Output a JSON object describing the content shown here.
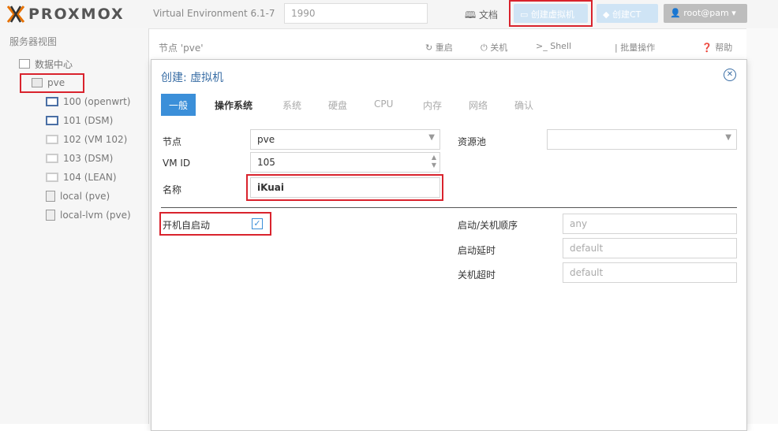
{
  "header": {
    "logo": "PROXMOX",
    "version": "Virtual Environment 6.1-7",
    "search_value": "1990",
    "docs_label": "文档",
    "create_vm_label": "创建虚拟机",
    "create_ct_label": "创建CT",
    "user_label": "root@pam"
  },
  "sidebar": {
    "title": "服务器视图",
    "datacenter": "数据中心",
    "node": "pve",
    "items": [
      {
        "label": "100 (openwrt)"
      },
      {
        "label": "101 (DSM)"
      },
      {
        "label": "102 (VM 102)"
      },
      {
        "label": "103 (DSM)"
      },
      {
        "label": "104 (LEAN)"
      },
      {
        "label": "local (pve)"
      },
      {
        "label": "local-lvm (pve)"
      }
    ]
  },
  "toolbar": {
    "title": "节点 'pve'",
    "restart": "重启",
    "shutdown": "关机",
    "shell": "Shell",
    "bulk": "批量操作",
    "help": "帮助"
  },
  "dialog": {
    "title": "创建: 虚拟机",
    "tabs": [
      "一般",
      "操作系统",
      "系统",
      "硬盘",
      "CPU",
      "内存",
      "网络",
      "确认"
    ],
    "node_label": "节点",
    "node_value": "pve",
    "vmid_label": "VM ID",
    "vmid_value": "105",
    "name_label": "名称",
    "name_value": "iKuai",
    "pool_label": "资源池",
    "autostart_label": "开机自启动",
    "order_label": "启动/关机顺序",
    "order_value": "any",
    "startup_delay_label": "启动延时",
    "startup_delay_value": "default",
    "shutdown_timeout_label": "关机超时",
    "shutdown_timeout_value": "default"
  },
  "colors": {
    "accent": "#3b8fd9",
    "highlight": "#d9232d",
    "brand_orange": "#e57000"
  }
}
